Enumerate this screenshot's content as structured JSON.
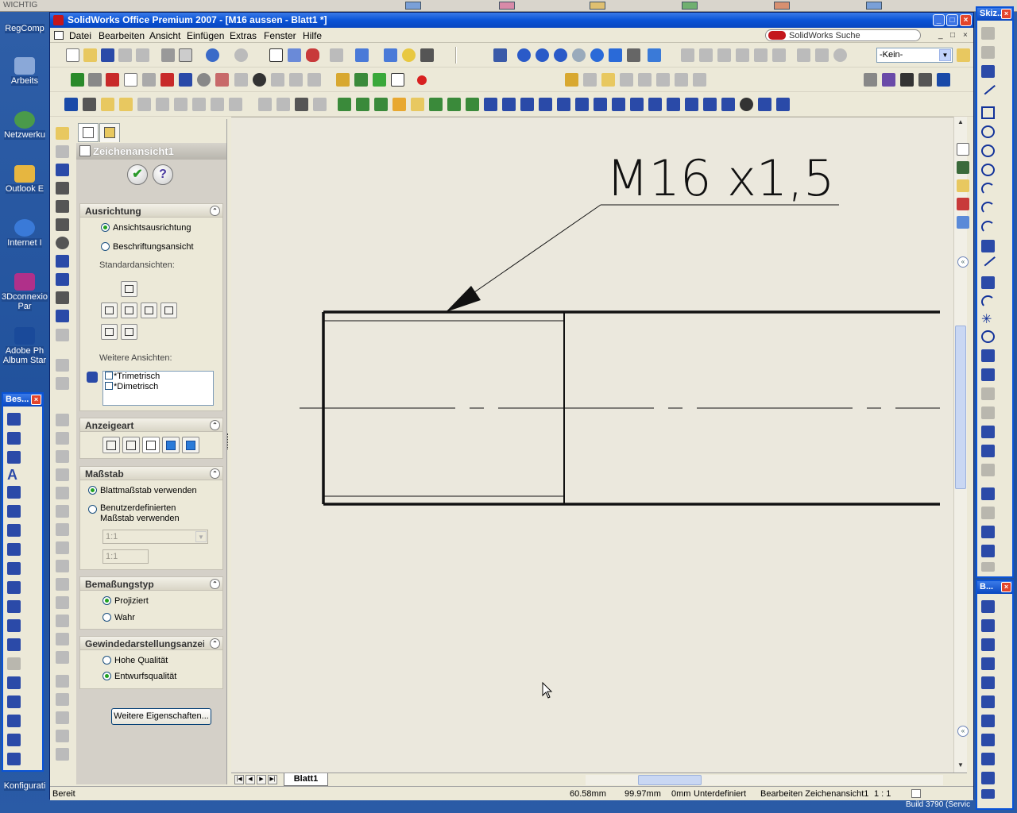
{
  "desktop": {
    "topbar_label": "WICHTIG",
    "icons": [
      {
        "label": "RegComp"
      },
      {
        "label": "Arbeits"
      },
      {
        "label": "Netzwerku"
      },
      {
        "label": "Outlook E"
      },
      {
        "label": "Internet I"
      },
      {
        "label": "3Dconnexio Par"
      },
      {
        "label": "Adobe Ph Album Star"
      },
      {
        "label": "Konfigurati"
      }
    ],
    "build_label": "Build 3790 (Servic"
  },
  "window": {
    "title": "SolidWorks Office Premium 2007 - [M16 aussen - Blatt1 *]",
    "minimize": "_",
    "maximize": "□",
    "close": "×"
  },
  "menu": {
    "items": [
      "Datei",
      "Bearbeiten",
      "Ansicht",
      "Einfügen",
      "Extras",
      "Fenster",
      "Hilfe"
    ],
    "search_label": "SolidWorks Suche",
    "mdi_buttons": [
      "_",
      "□",
      "×"
    ]
  },
  "toolbar": {
    "layer_combo": "-Kein-"
  },
  "property_manager": {
    "title": "Zeichenansicht1",
    "ok_label": "✔",
    "help_label": "?",
    "ausrichtung": {
      "heading": "Ausrichtung",
      "option1": "Ansichtsausrichtung",
      "option2": "Beschriftungsansicht",
      "standard_label": "Standardansichten:",
      "further_label": "Weitere Ansichten:",
      "list": [
        "*Trimetrisch",
        "*Dimetrisch"
      ]
    },
    "anzeigeart": {
      "heading": "Anzeigeart"
    },
    "massstab": {
      "heading": "Maßstab",
      "option1": "Blattmaßstab verwenden",
      "option2_line1": "Benutzerdefinierten",
      "option2_line2": "Maßstab verwenden",
      "combo_value": "1:1",
      "field_value": "1:1"
    },
    "bemassungstyp": {
      "heading": "Bemaßungstyp",
      "option1": "Projiziert",
      "option2": "Wahr"
    },
    "gewinde": {
      "heading": "Gewindedarstellungsanzeig",
      "option1": "Hohe Qualität",
      "option2": "Entwurfsqualität"
    },
    "more_button": "Weitere Eigenschaften..."
  },
  "drawing": {
    "annotation": "M16 x1,5",
    "sheet_tab": "Blatt1"
  },
  "statusbar": {
    "state": "Bereit",
    "x": "60.58mm",
    "y": "99.97mm",
    "z": "0mm",
    "definition": "Unterdefiniert",
    "mode": "Bearbeiten Zeichenansicht1",
    "scale": "1 : 1"
  },
  "float_windows": {
    "left_title": "Bes...",
    "right_top_title": "Skiz...",
    "right_bottom_title": "B..."
  },
  "colors": {
    "title_blue": "#0a53d6",
    "close_red": "#e3452b",
    "panel_bg": "#ece9d8",
    "sketch_blue": "#12329a"
  }
}
